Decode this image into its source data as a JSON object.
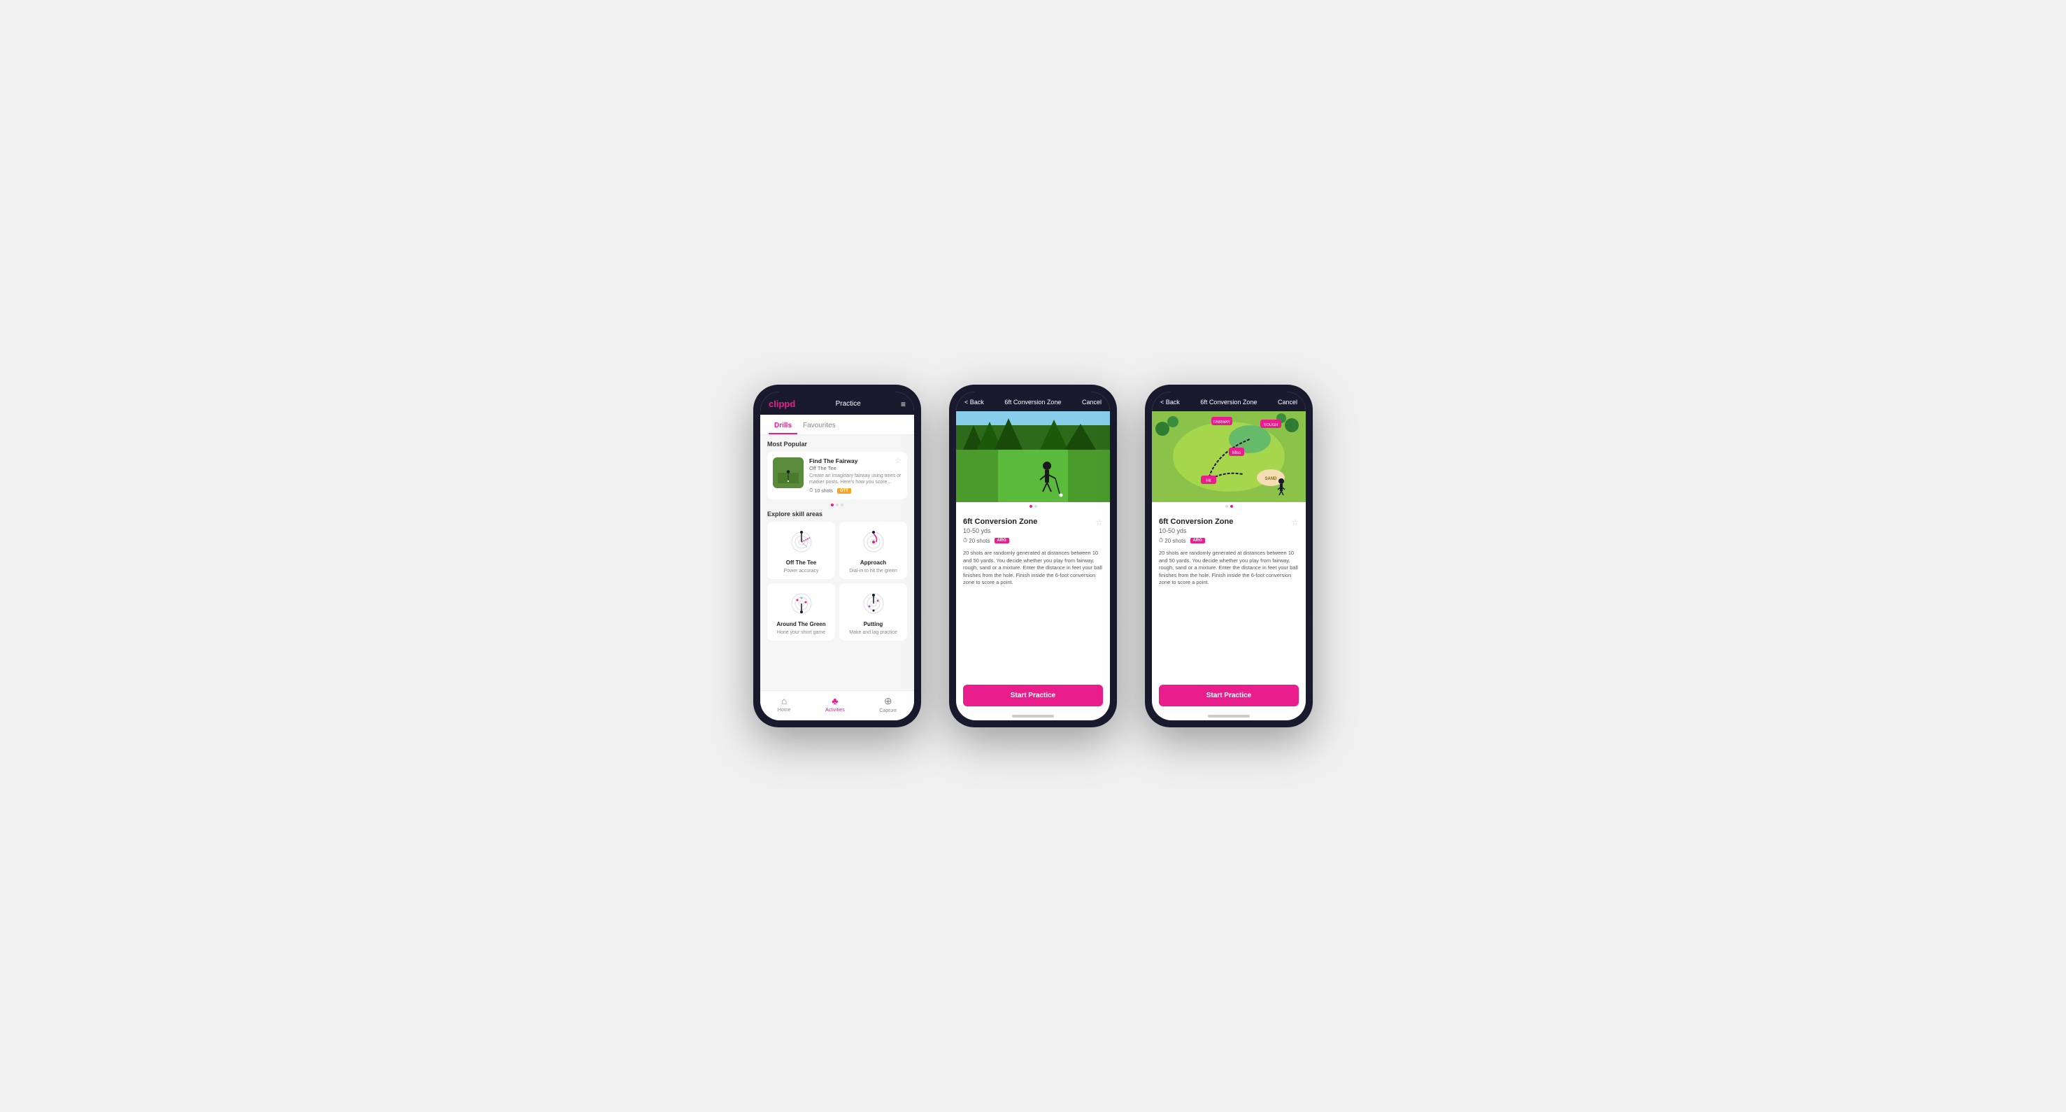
{
  "phones": {
    "phone1": {
      "header": {
        "logo": "clippd",
        "title": "Practice",
        "menu_icon": "≡"
      },
      "tabs": [
        {
          "label": "Drills",
          "active": true
        },
        {
          "label": "Favourites",
          "active": false
        }
      ],
      "most_popular_label": "Most Popular",
      "featured_drill": {
        "name": "Find The Fairway",
        "sub": "Off The Tee",
        "description": "Create an imaginary fairway using trees or marker posts. Here's how you score...",
        "shots": "10 shots",
        "tag": "OTT"
      },
      "explore_label": "Explore skill areas",
      "skills": [
        {
          "name": "Off The Tee",
          "desc": "Power accuracy"
        },
        {
          "name": "Approach",
          "desc": "Dial-in to hit the green"
        },
        {
          "name": "Around The Green",
          "desc": "Hone your short game"
        },
        {
          "name": "Putting",
          "desc": "Make and lag practice"
        }
      ],
      "nav": [
        {
          "label": "Home",
          "icon": "⌂",
          "active": false
        },
        {
          "label": "Activities",
          "icon": "♣",
          "active": true
        },
        {
          "label": "Capture",
          "icon": "⊕",
          "active": false
        }
      ]
    },
    "phone2": {
      "header": {
        "back": "< Back",
        "title": "6ft Conversion Zone",
        "cancel": "Cancel"
      },
      "drill": {
        "title": "6ft Conversion Zone",
        "yds": "10-50 yds",
        "shots": "20 shots",
        "tag": "ARG",
        "description": "20 shots are randomly generated at distances between 10 and 50 yards. You decide whether you play from fairway, rough, sand or a mixture. Enter the distance in feet your ball finishes from the hole. Finish inside the 6-foot conversion zone to score a point.",
        "start_btn": "Start Practice"
      }
    },
    "phone3": {
      "header": {
        "back": "< Back",
        "title": "6ft Conversion Zone",
        "cancel": "Cancel"
      },
      "drill": {
        "title": "6ft Conversion Zone",
        "yds": "10-50 yds",
        "shots": "20 shots",
        "tag": "ARG",
        "description": "20 shots are randomly generated at distances between 10 and 50 yards. You decide whether you play from fairway, rough, sand or a mixture. Enter the distance in feet your ball finishes from the hole. Finish inside the 6-foot conversion zone to score a point.",
        "start_btn": "Start Practice"
      }
    }
  }
}
